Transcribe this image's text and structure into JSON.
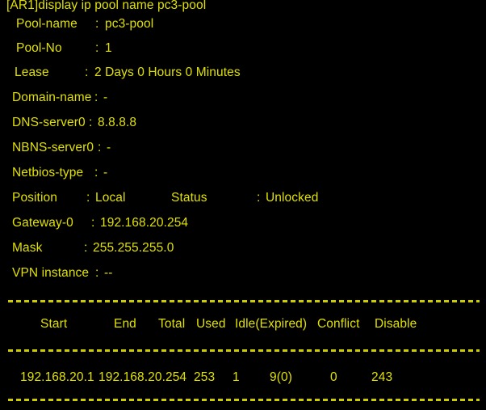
{
  "terminal": {
    "title": "Huawei VRP CLI - display ip pool",
    "background_color": "#000000",
    "text_color": "#e0e000",
    "prompt_line": "[AR1]display ip pool name pc3-pool"
  },
  "pool_info": {
    "rows": [
      {
        "label": "Pool-name",
        "colon": ":",
        "value": "pc3-pool"
      },
      {
        "label": "Pool-No",
        "colon": ":",
        "value": "1"
      },
      {
        "label": "Lease",
        "colon": ":",
        "value": "2 Days 0 Hours 0 Minutes"
      },
      {
        "label": "Domain-name",
        "colon": ":",
        "value": "-"
      },
      {
        "label": "DNS-server0",
        "colon": ":",
        "value": "8.8.8.8"
      },
      {
        "label": "NBNS-server0",
        "colon": ":",
        "value": "-"
      },
      {
        "label": "Netbios-type",
        "colon": ":",
        "value": "-"
      }
    ],
    "position_row": {
      "label": "Position",
      "colon": ":",
      "value": "Local",
      "status_label": "Status",
      "status_colon": ":",
      "status_value": "Unlocked"
    },
    "rows_after": [
      {
        "label": "Gateway-0",
        "colon": ":",
        "value": "192.168.20.254"
      },
      {
        "label": "Mask",
        "colon": ":",
        "value": "255.255.255.0"
      },
      {
        "label": "VPN instance",
        "colon": ":",
        "value": "--"
      }
    ]
  },
  "table": {
    "headers": {
      "start": "Start",
      "end": "End",
      "total": "Total",
      "used": "Used",
      "idle_expired": "Idle(Expired)",
      "conflict": "Conflict",
      "disable": "Disable"
    },
    "row": {
      "start": "192.168.20.1",
      "end": "192.168.20.254",
      "total": "253",
      "used": "1",
      "idle_expired": "9(0)",
      "conflict": "0",
      "disable": "243"
    }
  }
}
